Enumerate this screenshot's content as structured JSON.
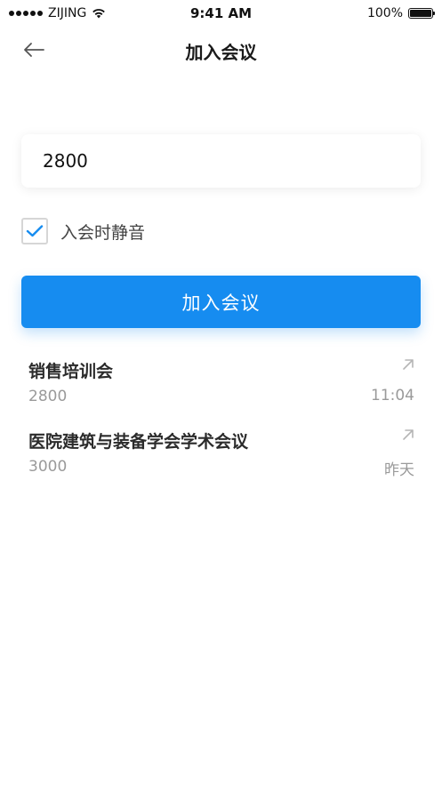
{
  "status_bar": {
    "carrier": "ZIJING",
    "time": "9:41 AM",
    "battery_percent": "100%",
    "battery_level": 1.0
  },
  "nav": {
    "title": "加入会议",
    "back_icon": "arrow-left-icon"
  },
  "form": {
    "meeting_number_value": "2800",
    "mute_label": "入会时静音",
    "mute_checked": true,
    "join_button_label": "加入会议"
  },
  "history": [
    {
      "title": "销售培训会",
      "number": "2800",
      "time": "11:04",
      "icon": "arrow-up-right-icon"
    },
    {
      "title": "医院建筑与装备学会学术会议",
      "number": "3000",
      "time": "昨天",
      "icon": "arrow-up-right-icon"
    }
  ],
  "colors": {
    "accent": "#168cf0",
    "text_primary": "#2b2b2b",
    "text_secondary": "#9a9a9a"
  }
}
